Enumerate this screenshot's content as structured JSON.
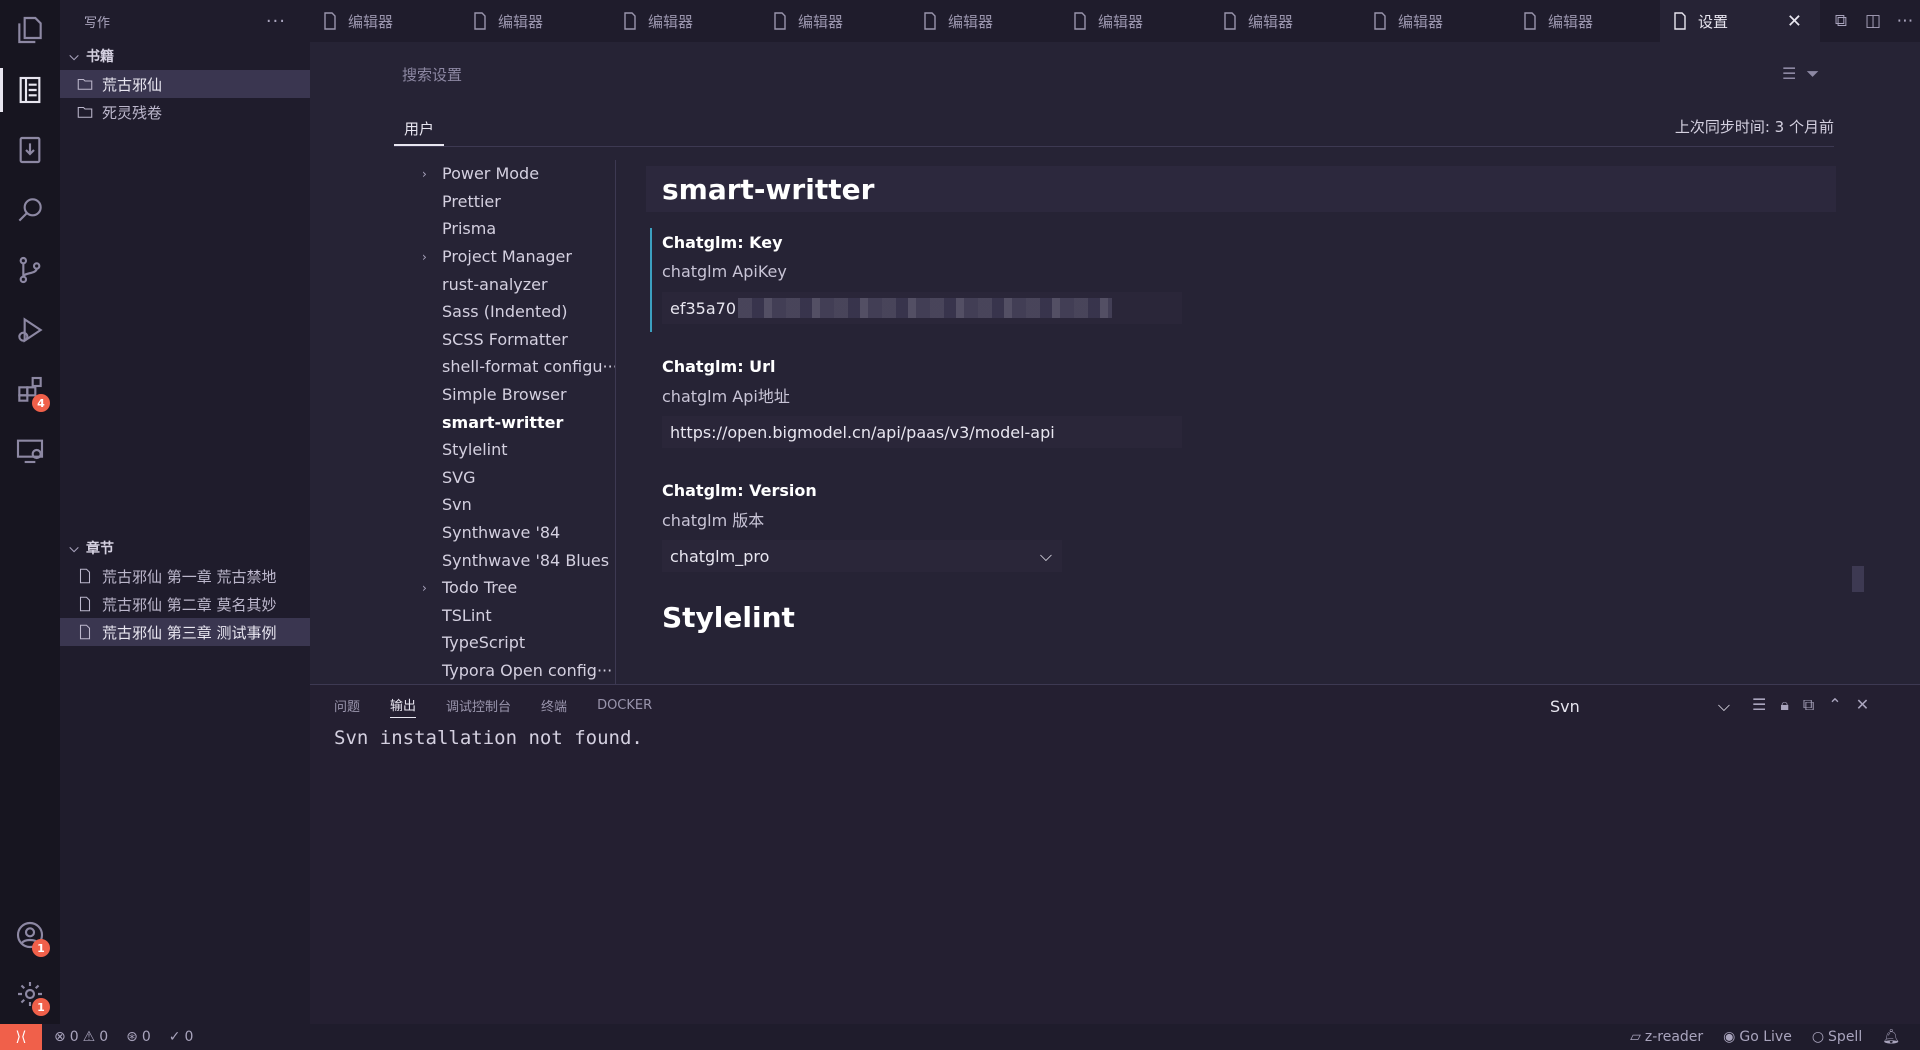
{
  "sidebar": {
    "title": "写作",
    "more": "···",
    "books_section": "书籍",
    "books": [
      "荒古邪仙",
      "死灵残卷"
    ],
    "chapters_section": "章节",
    "chapters": [
      "荒古邪仙 第一章 荒古禁地",
      "荒古邪仙 第二章 莫名其妙",
      "荒古邪仙 第三章 测试事例"
    ]
  },
  "activity": {
    "extensions_badge": "4",
    "accounts_badge": "1",
    "settings_badge": "1"
  },
  "tabs": {
    "items": [
      "编辑器",
      "编辑器",
      "编辑器",
      "编辑器",
      "编辑器",
      "编辑器",
      "编辑器",
      "编辑器",
      "编辑器"
    ],
    "active": "设置",
    "close": "✕"
  },
  "settings": {
    "search_placeholder": "搜索设置",
    "scope_user": "用户",
    "sync_time": "上次同步时间: 3 个月前",
    "toc": [
      {
        "label": "Power Mode",
        "expandable": true
      },
      {
        "label": "Prettier"
      },
      {
        "label": "Prisma"
      },
      {
        "label": "Project Manager",
        "expandable": true
      },
      {
        "label": "rust-analyzer"
      },
      {
        "label": "Sass (Indented)"
      },
      {
        "label": "SCSS Formatter"
      },
      {
        "label": "shell-format configu···"
      },
      {
        "label": "Simple Browser"
      },
      {
        "label": "smart-writter",
        "bold": true
      },
      {
        "label": "Stylelint"
      },
      {
        "label": "SVG"
      },
      {
        "label": "Svn"
      },
      {
        "label": "Synthwave '84"
      },
      {
        "label": "Synthwave '84 Blues"
      },
      {
        "label": "Todo Tree",
        "expandable": true
      },
      {
        "label": "TSLint"
      },
      {
        "label": "TypeScript"
      },
      {
        "label": "Typora Open config···"
      }
    ],
    "group_title": "smart-writter",
    "key": {
      "title": "Chatglm: Key",
      "desc": "chatglm ApiKey",
      "value": "ef35a70"
    },
    "url": {
      "title": "Chatglm: Url",
      "desc": "chatglm Api地址",
      "value": "https://open.bigmodel.cn/api/paas/v3/model-api"
    },
    "version": {
      "title": "Chatglm: Version",
      "desc": "chatglm 版本",
      "value": "chatglm_pro"
    },
    "next_group_title": "Stylelint"
  },
  "panel": {
    "tabs": [
      "问题",
      "输出",
      "调试控制台",
      "终端",
      "DOCKER"
    ],
    "active_tab": "输出",
    "output_channel": "Svn",
    "output_text": "Svn installation not found."
  },
  "status": {
    "errors": "0",
    "warnings": "0",
    "ports": "0",
    "checks": "0",
    "zreader": "z-reader",
    "golive": "Go Live",
    "spell": "Spell"
  }
}
